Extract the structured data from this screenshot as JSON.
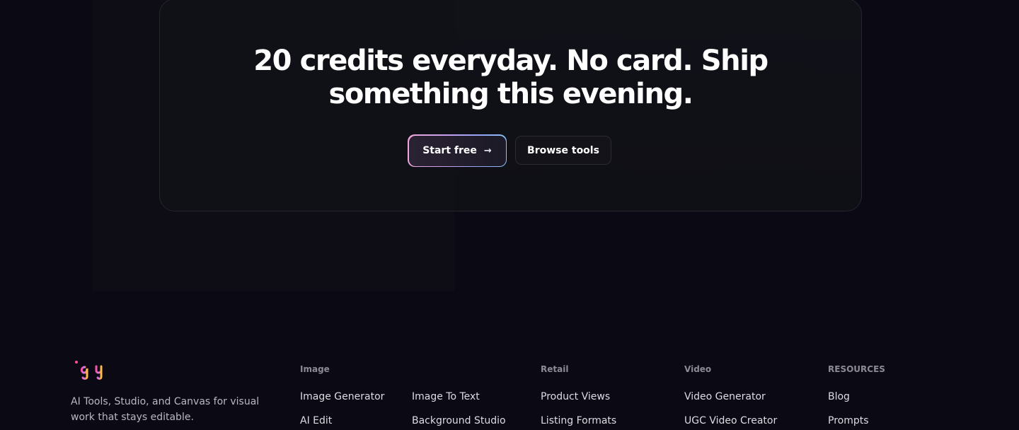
{
  "cta": {
    "title_line1": "20 credits everyday. No card. Ship",
    "title_line2": "something this evening.",
    "start_label": "Start free",
    "start_icon": "arrow-right-icon",
    "browse_label": "Browse tools"
  },
  "footer": {
    "logo_text": "igly",
    "tagline": "AI Tools, Studio, and Canvas for visual work that stays editable.",
    "columns": [
      {
        "heading": "Image",
        "links": [
          "Image Generator",
          "AI Edit",
          "Image To Text",
          "Background Studio"
        ]
      },
      {
        "heading": "Retail",
        "links": [
          "Product Views",
          "Listing Formats"
        ]
      },
      {
        "heading": "Video",
        "links": [
          "Video Generator",
          "UGC Video Creator"
        ]
      },
      {
        "heading": "RESOURCES",
        "links": [
          "Blog",
          "Prompts"
        ]
      }
    ]
  },
  "colors": {
    "background": "#0b0914",
    "card": "#111118",
    "accent_gradient": [
      "#f0a6d8",
      "#c6a0f2",
      "#8fa4f8",
      "#8fc3f5"
    ]
  }
}
